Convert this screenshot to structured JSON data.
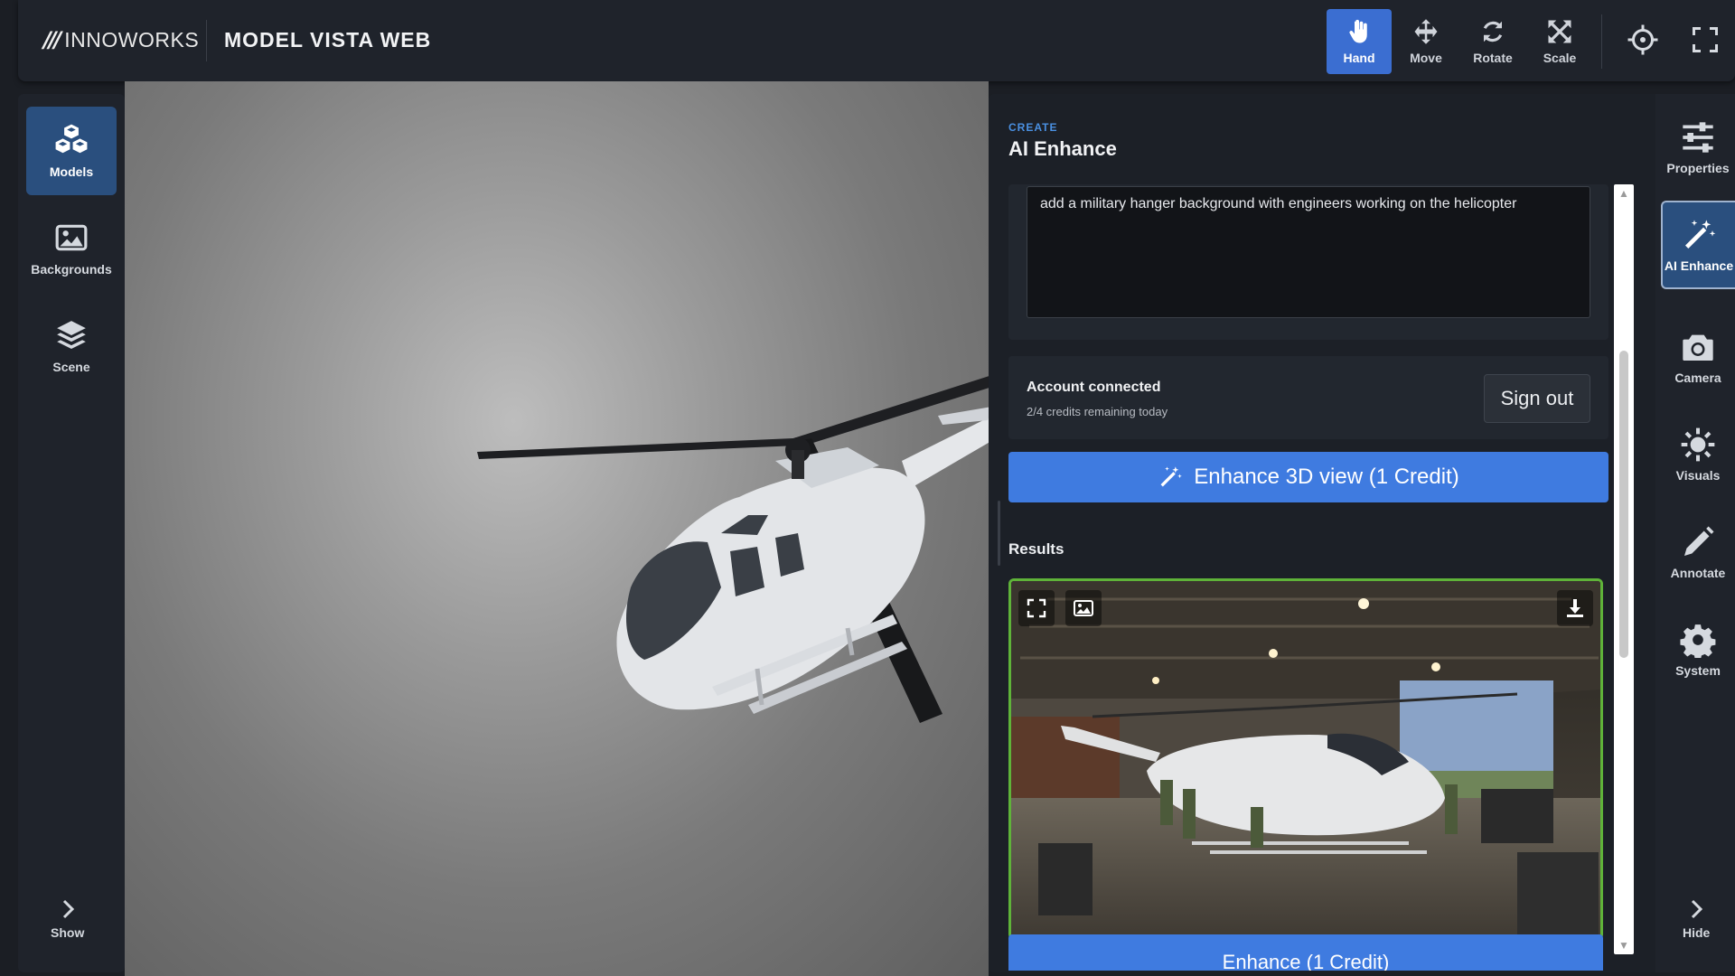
{
  "app": {
    "brand": "INNOWORKS",
    "title": "MODEL VISTA WEB"
  },
  "toolbar": {
    "tools": [
      {
        "label": "Hand",
        "icon": "hand-icon",
        "active": true
      },
      {
        "label": "Move",
        "icon": "move-icon",
        "active": false
      },
      {
        "label": "Rotate",
        "icon": "rotate-icon",
        "active": false
      },
      {
        "label": "Scale",
        "icon": "scale-icon",
        "active": false
      }
    ],
    "extra_icons": [
      "crosshair-icon",
      "fullscreen-icon"
    ]
  },
  "left_sidebar": {
    "items": [
      {
        "label": "Models",
        "icon": "cubes-icon",
        "active": true
      },
      {
        "label": "Backgrounds",
        "icon": "image-icon",
        "active": false
      },
      {
        "label": "Scene",
        "icon": "layers-icon",
        "active": false
      }
    ],
    "toggle_label": "Show"
  },
  "panel": {
    "section": "CREATE",
    "title": "AI Enhance",
    "prompt_value": "add a military hanger background with engineers working on the helicopter",
    "account": {
      "status": "Account connected",
      "credits": "2/4 credits remaining today",
      "signout_label": "Sign out"
    },
    "enhance_label": "Enhance 3D view (1 Credit)",
    "results_label": "Results",
    "partial_button_label": "Enhance (1 Credit)"
  },
  "right_sidebar": {
    "items": [
      {
        "label": "Properties",
        "icon": "sliders-icon",
        "active": false
      },
      {
        "label": "AI Enhance",
        "icon": "magic-wand-icon",
        "active": true
      },
      {
        "label": "Camera",
        "icon": "camera-icon",
        "active": false
      },
      {
        "label": "Visuals",
        "icon": "sun-icon",
        "active": false
      },
      {
        "label": "Annotate",
        "icon": "pencil-icon",
        "active": false
      },
      {
        "label": "System",
        "icon": "gear-icon",
        "active": false
      }
    ],
    "toggle_label": "Hide"
  },
  "colors": {
    "accent": "#3f7be0",
    "active_side": "#2a4f7e",
    "result_border": "#5fb339",
    "create_label": "#4a90e2"
  }
}
